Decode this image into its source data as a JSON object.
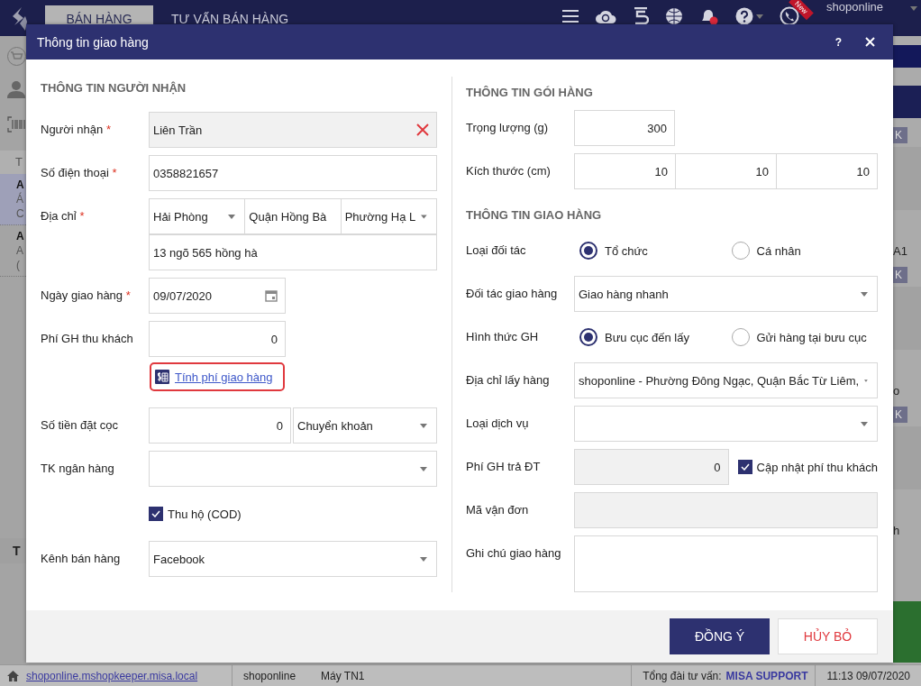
{
  "app_bar": {
    "tabs": [
      {
        "label": "BÁN HÀNG",
        "selected": true
      },
      {
        "label": "TƯ VẤN BÁN HÀNG",
        "selected": false
      }
    ],
    "new_badge": "New",
    "user": "shoponline"
  },
  "left_panel": {
    "header": "T",
    "items": [
      {
        "lines": [
          "A",
          "Á",
          "C"
        ],
        "selected": true
      },
      {
        "lines": [
          "A",
          "A",
          "("
        ],
        "selected": false
      }
    ],
    "footer": "T"
  },
  "right_panel": {
    "rows": [
      {
        "button": "K",
        "text": "A1"
      },
      {
        "button": "K",
        "text": "o"
      },
      {
        "button": "K",
        "text": "h"
      }
    ]
  },
  "dialog": {
    "title": "Thông tin giao hàng",
    "help": "?",
    "recipient": {
      "heading": "THÔNG TIN NGƯỜI NHẬN",
      "rows": [
        {
          "kind": "text",
          "label": "Người nhận",
          "required_mark": "*",
          "value": "Liên Trần",
          "readonly": true,
          "clearable": true
        },
        {
          "kind": "text",
          "label": "Số điện thoại",
          "required_mark": "*",
          "value": "0358821657",
          "readonly": false
        },
        {
          "kind": "address",
          "label": "Địa chỉ",
          "required_mark": "*",
          "selects": [
            "Hải Phòng",
            "Quận Hồng Bà",
            "Phường Hạ L"
          ],
          "value": "13 ngõ 565 hồng hà"
        },
        {
          "kind": "date",
          "label": "Ngày giao hàng",
          "required_mark": "*",
          "value": "09/07/2020"
        },
        {
          "kind": "number",
          "label": "Phí GH thu khách",
          "value": "0",
          "readonly": false
        },
        {
          "kind": "link",
          "text": "Tính phí giao hàng",
          "highlighted": true
        },
        {
          "kind": "number_select",
          "label": "Số tiền đặt cọc",
          "value": "0",
          "option": "Chuyển khoản"
        },
        {
          "kind": "select",
          "label": "TK ngân hàng"
        },
        {
          "kind": "checkbox",
          "text": "Thu hộ (COD)",
          "checked": true
        },
        {
          "kind": "select",
          "label": "Kênh bán hàng",
          "value": "Facebook"
        }
      ]
    },
    "package": {
      "heading": "THÔNG TIN GÓI HÀNG",
      "rows": [
        {
          "kind": "number",
          "label": "Trọng lượng (g)",
          "value": "300",
          "readonly": false
        },
        {
          "kind": "dimensions",
          "label": "Kích thước (cm)",
          "values": [
            "10",
            "10",
            "10"
          ]
        }
      ]
    },
    "delivery": {
      "heading": "THÔNG TIN GIAO HÀNG",
      "rows": [
        {
          "kind": "radio",
          "label": "Loại đối tác",
          "options": [
            {
              "label": "Tổ chức",
              "selected": true
            },
            {
              "label": "Cá nhân",
              "selected": false
            }
          ]
        },
        {
          "kind": "select",
          "label": "Đối tác giao hàng",
          "value": "Giao hàng nhanh"
        },
        {
          "kind": "radio",
          "label": "Hình thức GH",
          "options": [
            {
              "label": "Bưu cục đến lấy",
              "selected": true
            },
            {
              "label": "Gửi hàng tại bưu cục",
              "selected": false
            }
          ]
        },
        {
          "kind": "select",
          "label": "Địa chỉ lấy hàng",
          "value": "shoponline - Phường Đông Ngạc, Quận Bắc Từ Liêm,"
        },
        {
          "kind": "select",
          "label": "Loại dịch vụ"
        },
        {
          "kind": "number_check",
          "label": "Phí GH trả ĐT",
          "value": "0",
          "readonly": true,
          "check": {
            "text": "Cập nhật phí thu khách",
            "checked": true
          }
        },
        {
          "kind": "text",
          "label": "Mã vận đơn",
          "readonly": true
        },
        {
          "kind": "textarea",
          "label": "Ghi chú giao hàng"
        }
      ]
    },
    "buttons": [
      {
        "label": "ĐỒNG Ý",
        "kind": "primary"
      },
      {
        "label": "HỦY BỎ",
        "kind": "cancel"
      }
    ]
  },
  "status_bar": {
    "link": "shoponline.mshopkeeper.misa.local",
    "user": "shoponline",
    "device": "Máy TN1",
    "hotline_label": "Tổng đài tư vấn:",
    "hotline": "MISA SUPPORT",
    "time": "11:13 09/07/2020"
  }
}
